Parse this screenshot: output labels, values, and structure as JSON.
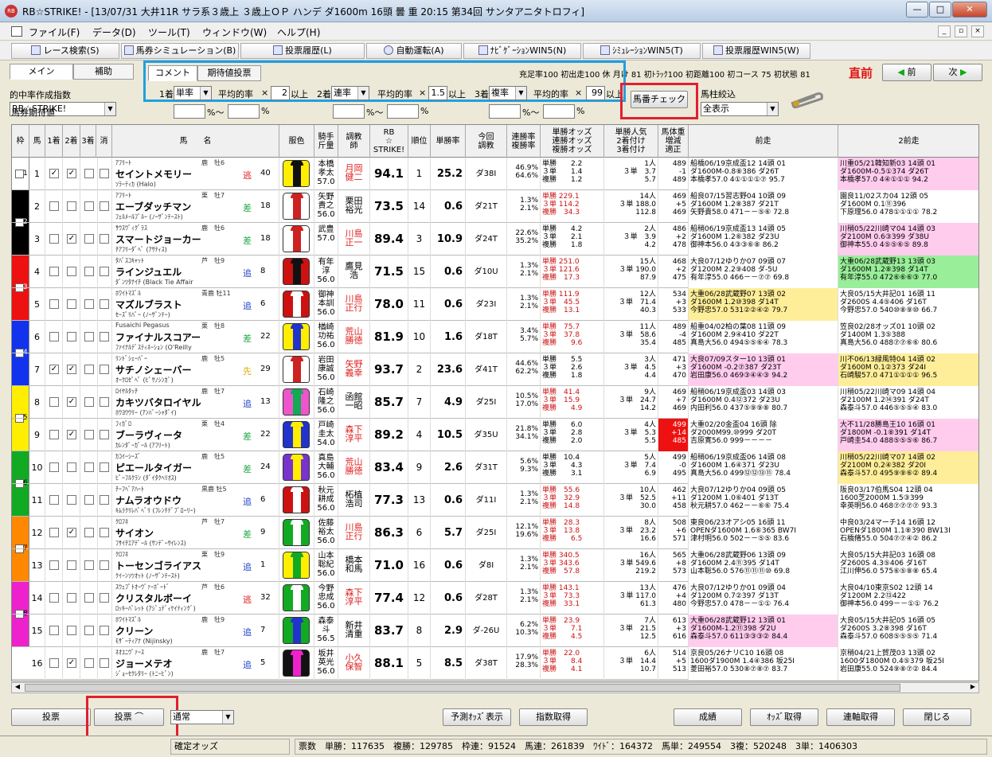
{
  "window": {
    "title": "RB☆STRIKE! - [13/07/31 大井11R サラ系３歳上 ３歳上ＯＰ ハンデ ダ1600m 16頭 曇 重 20:15 第34回 サンタアニタトロフィ]",
    "min": "—",
    "max": "□",
    "close": "✕"
  },
  "menu": [
    "ファイル(F)",
    "データ(D)",
    "ツール(T)",
    "ウィンドウ(W)",
    "ヘルプ(H)"
  ],
  "mdi": [
    "_",
    "▫",
    "×"
  ],
  "toolbar": [
    "レース検索(S)",
    "馬券シミュレーション(B)",
    "投票履歴(L)",
    "自動運転(A)",
    "ﾅﾋﾞｹﾞｰｼｮﾝWIN5(N)",
    "ｼﾐｭﾚｰｼｮﾝWIN5(T)",
    "投票履歴WIN5(W)"
  ],
  "tabs": {
    "main": "メイン",
    "sub": "補助",
    "comment": "コメント",
    "period": "期待値投票"
  },
  "stats": "充足率100 初出走100 休 月け 81 初ﾄﾗｯｸ100 初距離100 初コース 75 初状態 81",
  "chokuzen": "直前",
  "prev": "前",
  "next": "次",
  "hitRateLabel": "的中率作成指数",
  "indexSelect": "RB☆STRIKE!",
  "filter": {
    "c1": "1着",
    "t1": "単率",
    "avg": "平均的率",
    "x": "×",
    "v1": "2",
    "ijou": "以上",
    "c2": "2着",
    "t2": "連率",
    "v2": "1.5",
    "c3": "3着",
    "t3": "複率",
    "v3": "99",
    "ijou3": "以上"
  },
  "umaban": "馬番チェック",
  "bachu": "馬柱絞込",
  "allshow": "全表示",
  "expect": {
    "label": "馬券期待値",
    "pct": "%～",
    "pct2": "%"
  },
  "headers": [
    "枠",
    "馬",
    "1着",
    "2着",
    "3着",
    "消",
    "馬　　名",
    "服色",
    "騎手\n斤量",
    "調教\n師",
    "RB\n☆\nSTRIKE!",
    "順位",
    "単勝率",
    "今回\n調教",
    "連勝率\n複勝率",
    "単勝オッズ\n連勝オッズ\n複勝オッズ",
    "単勝人気\n2着付け\n3着付け",
    "馬体重\n増減\n適正",
    "前走",
    "2前走"
  ],
  "waku": [
    {
      "n": "1",
      "color": "#ffffff",
      "rows": 1
    },
    {
      "n": "2",
      "color": "#000000",
      "rows": 2
    },
    {
      "n": "3",
      "color": "#ee1111",
      "rows": 2
    },
    {
      "n": "4",
      "color": "#1133ee",
      "rows": 2
    },
    {
      "n": "5",
      "color": "#ffee00",
      "rows": 2
    },
    {
      "n": "6",
      "color": "#11aa22",
      "rows": 2
    },
    {
      "n": "7",
      "color": "#ff8800",
      "rows": 2
    },
    {
      "n": "8",
      "color": "#ee22cc",
      "rows": 2
    }
  ],
  "horses": [
    {
      "no": "1",
      "c1": "✓",
      "c2": "✓",
      "c3": "",
      "sire": "ｱﾌﾘｰﾄ",
      "sex": "鹿　牡6",
      "name": "セイントメモリー",
      "dam": "ｿﾗｰﾃｨｶ (Halo)",
      "style": "逃",
      "w": "40",
      "jockey": "本橋\n孝太\n57.0",
      "trainer": "月岡\n健二",
      "tred": true,
      "rb": "94.1",
      "rank": "1",
      "win": "25.2",
      "train": "ダ38Ⅰ",
      "r1": "46.9%\n64.6%",
      "odds": "単勝　　2.2\n３単　　1.4\n複勝　　1.2",
      "pop": "1人\n３単　3.7\n　　　5.7",
      "wt": "489\n-1\n489",
      "prev": "船橋06/19京成盃12 14頭 01\nダ1600M-0.8⑧386 ダ26T\n本橋孝57.0 4①①①①⑦ 95.7",
      "prev2": "川重05/21韓知新03 14頭 01\nダ1600M-0.5①374 ダ26T\n本橋孝57.0 4④①①① 94.2",
      "p1bg": "#ffffff",
      "p2bg": "#ffccee",
      "silk": [
        "#ffee00",
        "#111111"
      ]
    },
    {
      "no": "2",
      "c1": "",
      "c2": "",
      "c3": "",
      "sire": "ｱﾌﾘｰﾄ",
      "sex": "栗　牡7",
      "name": "エーブダッチマン",
      "dam": "ﾌｪﾙﾒｰﾙﾌﾞﾙｰ (ﾉｰｻﾞﾝﾃｰｽﾄ)",
      "style": "差",
      "w": "18",
      "jockey": "矢野\n貴之\n56.0",
      "trainer": "栗田\n裕光",
      "tred": false,
      "rb": "73.5",
      "rank": "14",
      "win": "0.6",
      "train": "ダ21T",
      "r1": "1.3%\n2.1%",
      "odds": "単勝 229.1\n３単 114.2\n複勝　34.3",
      "pop": "14人\n３単 188.0\n　　 112.8",
      "wt": "469\n+5\n469",
      "prev": "船良07/15習志野04 10頭 09\nダ1600M 1.2⑧387 ダ21T\n矢野貴58.0 471－－⑤⑥ 72.8",
      "prev2": "園良11/02スカ04 12頭 05\nダ1600M 0.1⑪396\n下原理56.0 478①①①① 78.2",
      "p1bg": "#ffffff",
      "p2bg": "#ffffff",
      "silk": [
        "#ffffff",
        "#cc2222"
      ]
    },
    {
      "no": "3",
      "c1": "",
      "c2": "✓",
      "c3": "",
      "sire": "ｻｳｽｳﾞｨｸﾞﾗｽ",
      "sex": "鹿　牡6",
      "name": "スマートジョーカー",
      "dam": "ﾁｱﾌﾘｰﾀﾞﾍﾞ (ｱｻﾃｨｽ)",
      "style": "差",
      "w": "18",
      "jockey": "武豊\n57.0",
      "trainer": "川島\n正一",
      "tred": true,
      "rb": "89.4",
      "rank": "3",
      "win": "10.9",
      "train": "ダ24T",
      "r1": "22.6%\n35.2%",
      "odds": "単勝　　4.2\n３単　　2.1\n複勝　　1.8",
      "pop": "2人\n３単　3.9\n　　　4.2",
      "wt": "486\n+2\n478",
      "prev": "船稍06/19京成盃13 14頭 05\nダ1600M 1.2⑥382 ダ23U\n御神本56.0 4③③⑥⑧ 86.2",
      "prev2": "川稍05/22川崎マ04 14頭 03\nダ2100M 0.6③399 ダ38U\n御神本55.0 4⑤⑤⑥⑤ 89.8",
      "p1bg": "#ffffff",
      "p2bg": "#ffccee",
      "silk": [
        "#ffffff",
        "#cc2222"
      ]
    },
    {
      "no": "4",
      "c1": "",
      "c2": "",
      "c3": "",
      "sire": "ﾀﾊﾞｽｺｷｬｯﾄ",
      "sex": "芦　牡9",
      "name": "ラインジュエル",
      "dam": "ﾀﾞﾝﾂﾀﾅｲﾁ (Black Tie Affair",
      "style": "追",
      "w": "8",
      "jockey": "有年\n淳\n56.0",
      "trainer": "鷹見\n浩",
      "tred": false,
      "rb": "71.5",
      "rank": "15",
      "win": "0.6",
      "train": "ダ10U",
      "r1": "1.3%\n2.1%",
      "odds": "単勝 251.0\n３単 121.6\n複勝　17.3",
      "pop": "15人\n３単 190.0\n　　　87.9",
      "wt": "468\n+2\n475",
      "prev": "大良07/12ゆりか07 09頭 07\nダ1200M 2.2⑨408 ダ-5U\n有年淳55.0 466－－⑦⑦ 69.8",
      "prev2": "大重06/28武蔵野13 13頭 03\nダ1600M 1.2⑧398 ダ14T\n有年淳55.0 472⑥⑥⑥③ 77.0",
      "p1bg": "#ffffff",
      "p2bg": "#99ee99",
      "silk": [
        "#cc1111",
        "#111111"
      ]
    },
    {
      "no": "5",
      "c1": "",
      "c2": "",
      "c3": "",
      "sire": "ﾎﾜｲﾄﾏｽﾞﾙ",
      "sex": "青鹿 牡11",
      "name": "マズルブラスト",
      "dam": "ｾｰｽﾞﾘﾊﾞｰ (ﾉｰｻﾞﾝﾃｰ)",
      "style": "追",
      "w": "6",
      "jockey": "御神\n本訓\n56.0",
      "trainer": "川島\n正行",
      "tred": true,
      "rb": "78.0",
      "rank": "11",
      "win": "0.6",
      "train": "ダ23Ⅰ",
      "r1": "1.3%\n2.1%",
      "odds": "単勝 111.9\n３単　45.5\n複勝　13.1",
      "pop": "12人\n３単　71.4\n　　　40.3",
      "wt": "534\n+3\n533",
      "prev": "大重06/28武蔵野07 13頭 02\nダ1600M 1.2⑩398 ダ14T\n今野忠57.0 531②②④② 79.7",
      "prev2": "大良05/15大井記01 16頭 11\nダ2600S 4.4⑤406 ダ16T\n今野忠57.0 540⑩⑧⑨⑩ 66.7",
      "p1bg": "#ffee99",
      "p2bg": "#ffffff",
      "silk": [
        "#cc1111",
        "#ffffff"
      ]
    },
    {
      "no": "6",
      "c1": "",
      "c2": "",
      "c3": "",
      "sire": "Fusaichi Pegasus",
      "sex": "栗　牡8",
      "name": "ファイナルスコアー",
      "dam": "ﾌｧｲﾅﾙﾃﾞｽﾃｨﾈｰｼｮﾝ (O'Reilly",
      "style": "差",
      "w": "22",
      "jockey": "楢崎\n功祐\n56.0",
      "trainer": "荒山\n勝徳",
      "tred": true,
      "rb": "81.9",
      "rank": "10",
      "win": "1.6",
      "train": "ダ18T",
      "r1": "3.4%\n5.7%",
      "odds": "単勝　75.7\n３単　37.8\n複勝　　9.6",
      "pop": "11人\n３単　58.6\n　　　35.4",
      "wt": "489\n-4\n485",
      "prev": "船重04/02柏の葉08 11頭 09\nダ1600M 2.9④410 ダ22T\n真島大56.0 494⑤⑤⑥④ 78.3",
      "prev2": "笠良02/28オッズ01 10頭 02\nダ1400M 1.3⑤388\n真島大56.0 488⑦⑦⑥⑥ 80.6",
      "p1bg": "#ffffff",
      "p2bg": "#ffffff",
      "silk": [
        "#ffee00",
        "#2233cc"
      ]
    },
    {
      "no": "7",
      "c1": "✓",
      "c2": "✓",
      "c3": "",
      "sire": "ﾘﾝﾄﾞｼｪｰﾊﾞｰ",
      "sex": "鹿　牡5",
      "name": "サチノシェーバー",
      "dam": "ｵｰｸﾛｾﾞﾍﾞ (ﾋﾟｻﾉｼﾝｶﾞ)",
      "style": "先",
      "w": "29",
      "jockey": "岩田\n康誠\n56.0",
      "trainer": "矢野\n義幸",
      "tred": true,
      "rb": "93.7",
      "rank": "2",
      "win": "23.6",
      "train": "ダ41T",
      "r1": "44.6%\n62.2%",
      "odds": "単勝　　5.5\n３単　　2.6\n複勝　　1.8",
      "pop": "3人\n３単　4.5\n　　　4.4",
      "wt": "471\n+3\n470",
      "prev": "大良07/09スター10 13頭 01\nダ1600M -0.2⑦387 ダ23T\n岩田康56.0 469③④④③ 94.2",
      "prev2": "川不06/13緑風特04 14頭 02\nダ1600M 0.1②373 ダ24Ⅰ\n石崎駿57.0 471①①①① 96.5",
      "p1bg": "#ffccee",
      "p2bg": "#ffee99",
      "silk": [
        "#ffffff",
        "#cc2222"
      ]
    },
    {
      "no": "8",
      "c1": "",
      "c2": "✓",
      "c3": "",
      "sire": "ﾛｲﾔﾙﾀｯﾁ",
      "sex": "鹿　牡7",
      "name": "カキツバタロイヤル",
      "dam": "ﾎｳﾖｳｳﾘｰ (ｱﾝﾊﾞｰｼｬﾀﾞｲ)",
      "style": "追",
      "w": "13",
      "jockey": "石崎\n隆之\n56.0",
      "trainer": "函館\n一昭",
      "tred": false,
      "rb": "85.7",
      "rank": "7",
      "win": "4.9",
      "train": "ダ25Ⅰ",
      "r1": "10.5%\n17.0%",
      "odds": "単勝　41.4\n３単　15.9\n複勝　　4.9",
      "pop": "9人\n３単　24.7\n　　　14.2",
      "wt": "469\n+7\n469",
      "prev": "船稍06/19京成盃03 14頭 03\nダ1600M 0.4⑫372 ダ23U\n内田利56.0 437⑤⑨⑨⑧ 80.7",
      "prev2": "川稍05/22川崎マ09 14頭 04\nダ2100M 1.2⑭391 ダ24T\n森泰斗57.0 446⑤⑤⑤④ 83.0",
      "p1bg": "#ffffff",
      "p2bg": "#ffffff",
      "silk": [
        "#ee55cc",
        "#11aa55"
      ]
    },
    {
      "no": "9",
      "c1": "",
      "c2": "✓",
      "c3": "",
      "sire": "ﾌｨｶﾞﾛ",
      "sex": "栗　牡4",
      "name": "ブーラヴィータ",
      "dam": "ｶﾚﾝﾀﾞｰｶﾞｰﾙ (ｱﾌﾘｰﾄ)",
      "style": "差",
      "w": "22",
      "jockey": "戸崎\n圭太\n54.0",
      "trainer": "森下\n淳平",
      "tred": true,
      "rb": "89.2",
      "rank": "4",
      "win": "10.5",
      "train": "ダ35U",
      "r1": "21.8%\n34.1%",
      "odds": "単勝　　6.0\n３単　　2.8\n複勝　　2.0",
      "pop": "4人\n３単　5.3\n　　　5.5",
      "wt": "499\n+14\n485",
      "prev": "大重02/20金盃04 16頭 除\nダ2000M99.⑩999 ダ20T\n吉原寛56.0 999－－－－",
      "prev2": "大不11/28勝島王10 16頭 01\nダ1800M -0.1⑧391 ダ14T\n戸崎圭54.0 488⑤⑤⑤⑥ 86.7",
      "p1bg": "#ffffff",
      "p2bg": "#ffccee",
      "wtred": true,
      "silk": [
        "#2233cc",
        "#ffee00"
      ]
    },
    {
      "no": "10",
      "c1": "",
      "c2": "",
      "c3": "",
      "sire": "ｶｺｲｰｼｰｽﾞ",
      "sex": "鹿　牡5",
      "name": "ピエールタイガー",
      "dam": "ﾋﾟｰﾌﾙｸﾗﾝ (ﾀﾞｲﾀｸﾍﾘｵｽ)",
      "style": "差",
      "w": "24",
      "jockey": "真島\n大輔\n56.0",
      "trainer": "荒山\n勝徳",
      "tred": true,
      "rb": "83.4",
      "rank": "9",
      "win": "2.6",
      "train": "ダ31T",
      "r1": "5.6%\n9.3%",
      "odds": "単勝　10.4\n３単　　4.3\n複勝　　3.1",
      "pop": "5人\n３単　7.4\n　　　6.9",
      "wt": "499\n-0\n495",
      "prev": "船稍06/19京成盃06 14頭 08\nダ1600M 1.6④371 ダ23U\n真島大56.0 499⑫⑫⑬⑪ 78.4",
      "prev2": "川稍05/22川崎マ07 14頭 02\nダ2100M 0.2④382 ダ20Ⅰ\n森泰斗57.0 495⑨⑨⑥② 89.4",
      "p1bg": "#ffffff",
      "p2bg": "#ffee99",
      "silk": [
        "#7733cc",
        "#ffee00"
      ]
    },
    {
      "no": "11",
      "c1": "",
      "c2": "",
      "c3": "",
      "sire": "ﾁｰﾌﾍﾞｱﾊｰﾄ",
      "sex": "黒鹿 牡5",
      "name": "ナムラオウドウ",
      "dam": "ｷﾑﾗｸﾘﾚﾊﾞﾍﾞﾘ (ﾌﾚﾝﾁﾃﾞﾌﾟﾛｰﾘｰ)",
      "style": "追",
      "w": "6",
      "jockey": "秋元\n耕成\n56.0",
      "trainer": "柘植\n浩司",
      "tred": false,
      "rb": "77.3",
      "rank": "13",
      "win": "0.6",
      "train": "ダ11Ⅰ",
      "r1": "1.3%\n2.1%",
      "odds": "単勝　55.6\n３単　32.9\n複勝　14.8",
      "pop": "10人\n３単　52.5\n　　　30.0",
      "wt": "462\n+11\n458",
      "prev": "大良07/12ゆりか04 09頭 05\nダ1200M 1.0⑥401 ダ13T\n秋元耕57.0 462－－⑥⑥ 75.4",
      "prev2": "阪良03/17伯馬S04 12頭 04\n1600芝2000M 1.5③399\n幸英明56.0 468⑦⑦⑦⑦ 93.3",
      "p1bg": "#ffffff",
      "p2bg": "#ffffff",
      "silk": [
        "#cc1111",
        "#ffffff"
      ]
    },
    {
      "no": "12",
      "c1": "",
      "c2": "✓",
      "c3": "",
      "sire": "ｸﾛﾌﾈ",
      "sex": "芦　牡7",
      "name": "サイオン",
      "dam": "ﾌｻｲﾁｴｱﾃﾞｰﾙ (ｻﾝﾃﾞｰｻｲﾚﾝｽ)",
      "style": "差",
      "w": "9",
      "jockey": "佐藤\n裕太\n56.0",
      "trainer": "川島\n正行",
      "tred": true,
      "rb": "86.3",
      "rank": "6",
      "win": "5.7",
      "train": "ダ25Ⅰ",
      "r1": "12.1%\n19.6%",
      "odds": "単勝　28.3\n３単　13.8\n複勝　　6.5",
      "pop": "8人\n３単　23.2\n　　　16.6",
      "wt": "508\n+6\n571",
      "prev": "東良06/23オアシ05 16頭 11\nOPENダ1600M 1.6⑥365 BW7Ⅰ\n津村明56.0 502－－⑤⑤ 83.6",
      "prev2": "中良03/24マーチ14 16頭 12\nOPENダ1800M 1.1⑧390 BW13Ⅰ\n石橋脩55.0 504⑦⑦④② 86.2",
      "p1bg": "#ffffff",
      "p2bg": "#ffffff",
      "silk": [
        "#11aa22",
        "#ffffff"
      ]
    },
    {
      "no": "13",
      "c1": "",
      "c2": "",
      "c3": "",
      "sire": "ｸﾛﾌﾈ",
      "sex": "栗　牡9",
      "name": "トーセンゴライアス",
      "dam": "ｸｲｰﾝｿﾂｵｯﾄ (ﾉｰｻﾞﾝﾃｰｽﾄ)",
      "style": "追",
      "w": "1",
      "jockey": "山本\n聡紀\n56.0",
      "trainer": "橋本\n和馬",
      "tred": false,
      "rb": "71.0",
      "rank": "16",
      "win": "0.6",
      "train": "ダ8Ⅰ",
      "r1": "1.3%\n2.1%",
      "odds": "単勝 340.5\n３単 343.6\n複勝　57.8",
      "pop": "16人\n３単 549.6\n　　 219.2",
      "wt": "565\n+8\n573",
      "prev": "大重06/28武蔵野06 13頭 09\nダ1600M 2.4⑪395 ダ14T\n山本聡56.0 576⑪⑪⑪⑩ 69.8",
      "prev2": "大良05/15大井記03 16頭 08\nダ2600S 4.3⑤406 ダ16T\n江川伸56.0 575⑥⑤⑧⑧ 65.4",
      "p1bg": "#ffffff",
      "p2bg": "#ffffff",
      "silk": [
        "#ffee00",
        "#11aa22"
      ]
    },
    {
      "no": "14",
      "c1": "",
      "c2": "",
      "c3": "",
      "sire": "ｽｳｪﾌﾟﾄｵｰｳﾞｧｰﾎﾞｰﾄﾞ",
      "sex": "芦　牡6",
      "name": "クリスタルボーイ",
      "dam": "ﾛｯｷｰﾊﾟﾚｯﾄ (ｱｼﾞｭﾃﾞｨｹｲﾃｨﾝｸﾞ)",
      "style": "逃",
      "w": "32",
      "jockey": "今野\n忠成\n56.0",
      "trainer": "森下\n淳平",
      "tred": true,
      "rb": "77.4",
      "rank": "12",
      "win": "0.6",
      "train": "ダ28T",
      "r1": "1.3%\n2.1%",
      "odds": "単勝 143.1\n３単　73.3\n複勝　33.1",
      "pop": "13人\n３単 117.0\n　　　61.3",
      "wt": "476\n+4\n480",
      "prev": "大良07/12ゆりか01 09頭 04\nダ1200M 0.7②397 ダ13T\n今野忠57.0 478－－①① 76.4",
      "prev2": "大良04/10東京S02 12頭 14\nダ1200M 2.2⑬422\n御神本56.0 499－－①① 76.2",
      "p1bg": "#ffffff",
      "p2bg": "#ffffff",
      "silk": [
        "#11aa22",
        "#ffffff"
      ]
    },
    {
      "no": "15",
      "c1": "",
      "c2": "",
      "c3": "",
      "sire": "ﾎﾜｲﾄﾏｽﾞﾙ",
      "sex": "鹿　牡9",
      "name": "クリーン",
      "dam": "ﾓｻﾞｰﾃｨｱﾅ (Nijinsky)",
      "style": "追",
      "w": "7",
      "jockey": "森泰\n斗\n56.5",
      "trainer": "新井\n清重",
      "tred": false,
      "rb": "83.7",
      "rank": "8",
      "win": "2.9",
      "train": "ダ-26U",
      "r1": "6.2%\n10.3%",
      "odds": "単勝　23.9\n３単　　7.1\n複勝　　4.5",
      "pop": "7人\n３単　21.5\n　　　12.5",
      "wt": "613\n+3\n616",
      "prev": "大重06/28武蔵野12 13頭 01\nダ1600M-1.2⑪398 ダ2U\n森泰斗57.0 611③③③② 84.4",
      "prev2": "大良05/15大井記05 16頭 05\nダ2600S 3.2⑧398 ダ16T\n森泰斗57.0 608⑤⑤⑤⑤ 71.4",
      "p1bg": "#ffccee",
      "p2bg": "#ffffff",
      "silk": [
        "#11aa22",
        "#2233cc"
      ]
    },
    {
      "no": "16",
      "c1": "",
      "c2": "✓",
      "c3": "",
      "sire": "ﾈｵﾕﾆｳﾞｧｰｽ",
      "sex": "鹿　牡7",
      "name": "ジョーメテオ",
      "dam": "ｼﾞｮｰｾｸﾚﾀﾘｰ (ﾄﾆｰﾋﾞﾝ)",
      "style": "追",
      "w": "5",
      "jockey": "坂井\n英光\n56.0",
      "trainer": "小久\n保智",
      "tred": true,
      "rb": "88.1",
      "rank": "5",
      "win": "8.5",
      "train": "ダ38T",
      "r1": "17.9%\n28.3%",
      "odds": "単勝　22.0\n３単　　8.4\n複勝　　4.1",
      "pop": "6人\n３単　14.4\n　　　10.7",
      "wt": "514\n+5\n513",
      "prev": "京良05/26ナリC10 16頭 08\n1600ダ1900M 1.4④386 坂25Ⅰ\n菱田裕57.0 530⑧⑦⑧⑦ 83.7",
      "prev2": "京稍04/21上賀茂03 13頭 02\n1600ダ1800M 0.4⑤379 坂25Ⅰ\n岩田康55.0 524⑨⑧⑦② 84.4",
      "p1bg": "#ffffff",
      "p2bg": "#ffffff",
      "silk": [
        "#111111",
        "#ee22cc"
      ]
    }
  ],
  "bottom": {
    "vote": "投票",
    "vote2": "投票",
    "mode": "通常",
    "predict": "予測ｵｯｽﾞ表示",
    "getindex": "指数取得",
    "result": "成績",
    "oddsget": "ｵｯｽﾞ取得",
    "renpuku": "連軸取得",
    "close": "閉じる"
  },
  "status": {
    "kakutei": "確定オッズ",
    "hyou": "票数",
    "tan": "単勝：117635",
    "fuku": "複勝：129785",
    "waku": "枠連：91524",
    "umaren": "馬連：261839",
    "wide": "ﾜｲﾄﾞ：164372",
    "umatan": "馬単：249554",
    "fuku3": "3複：520248",
    "tan3": "3単：1406303"
  }
}
